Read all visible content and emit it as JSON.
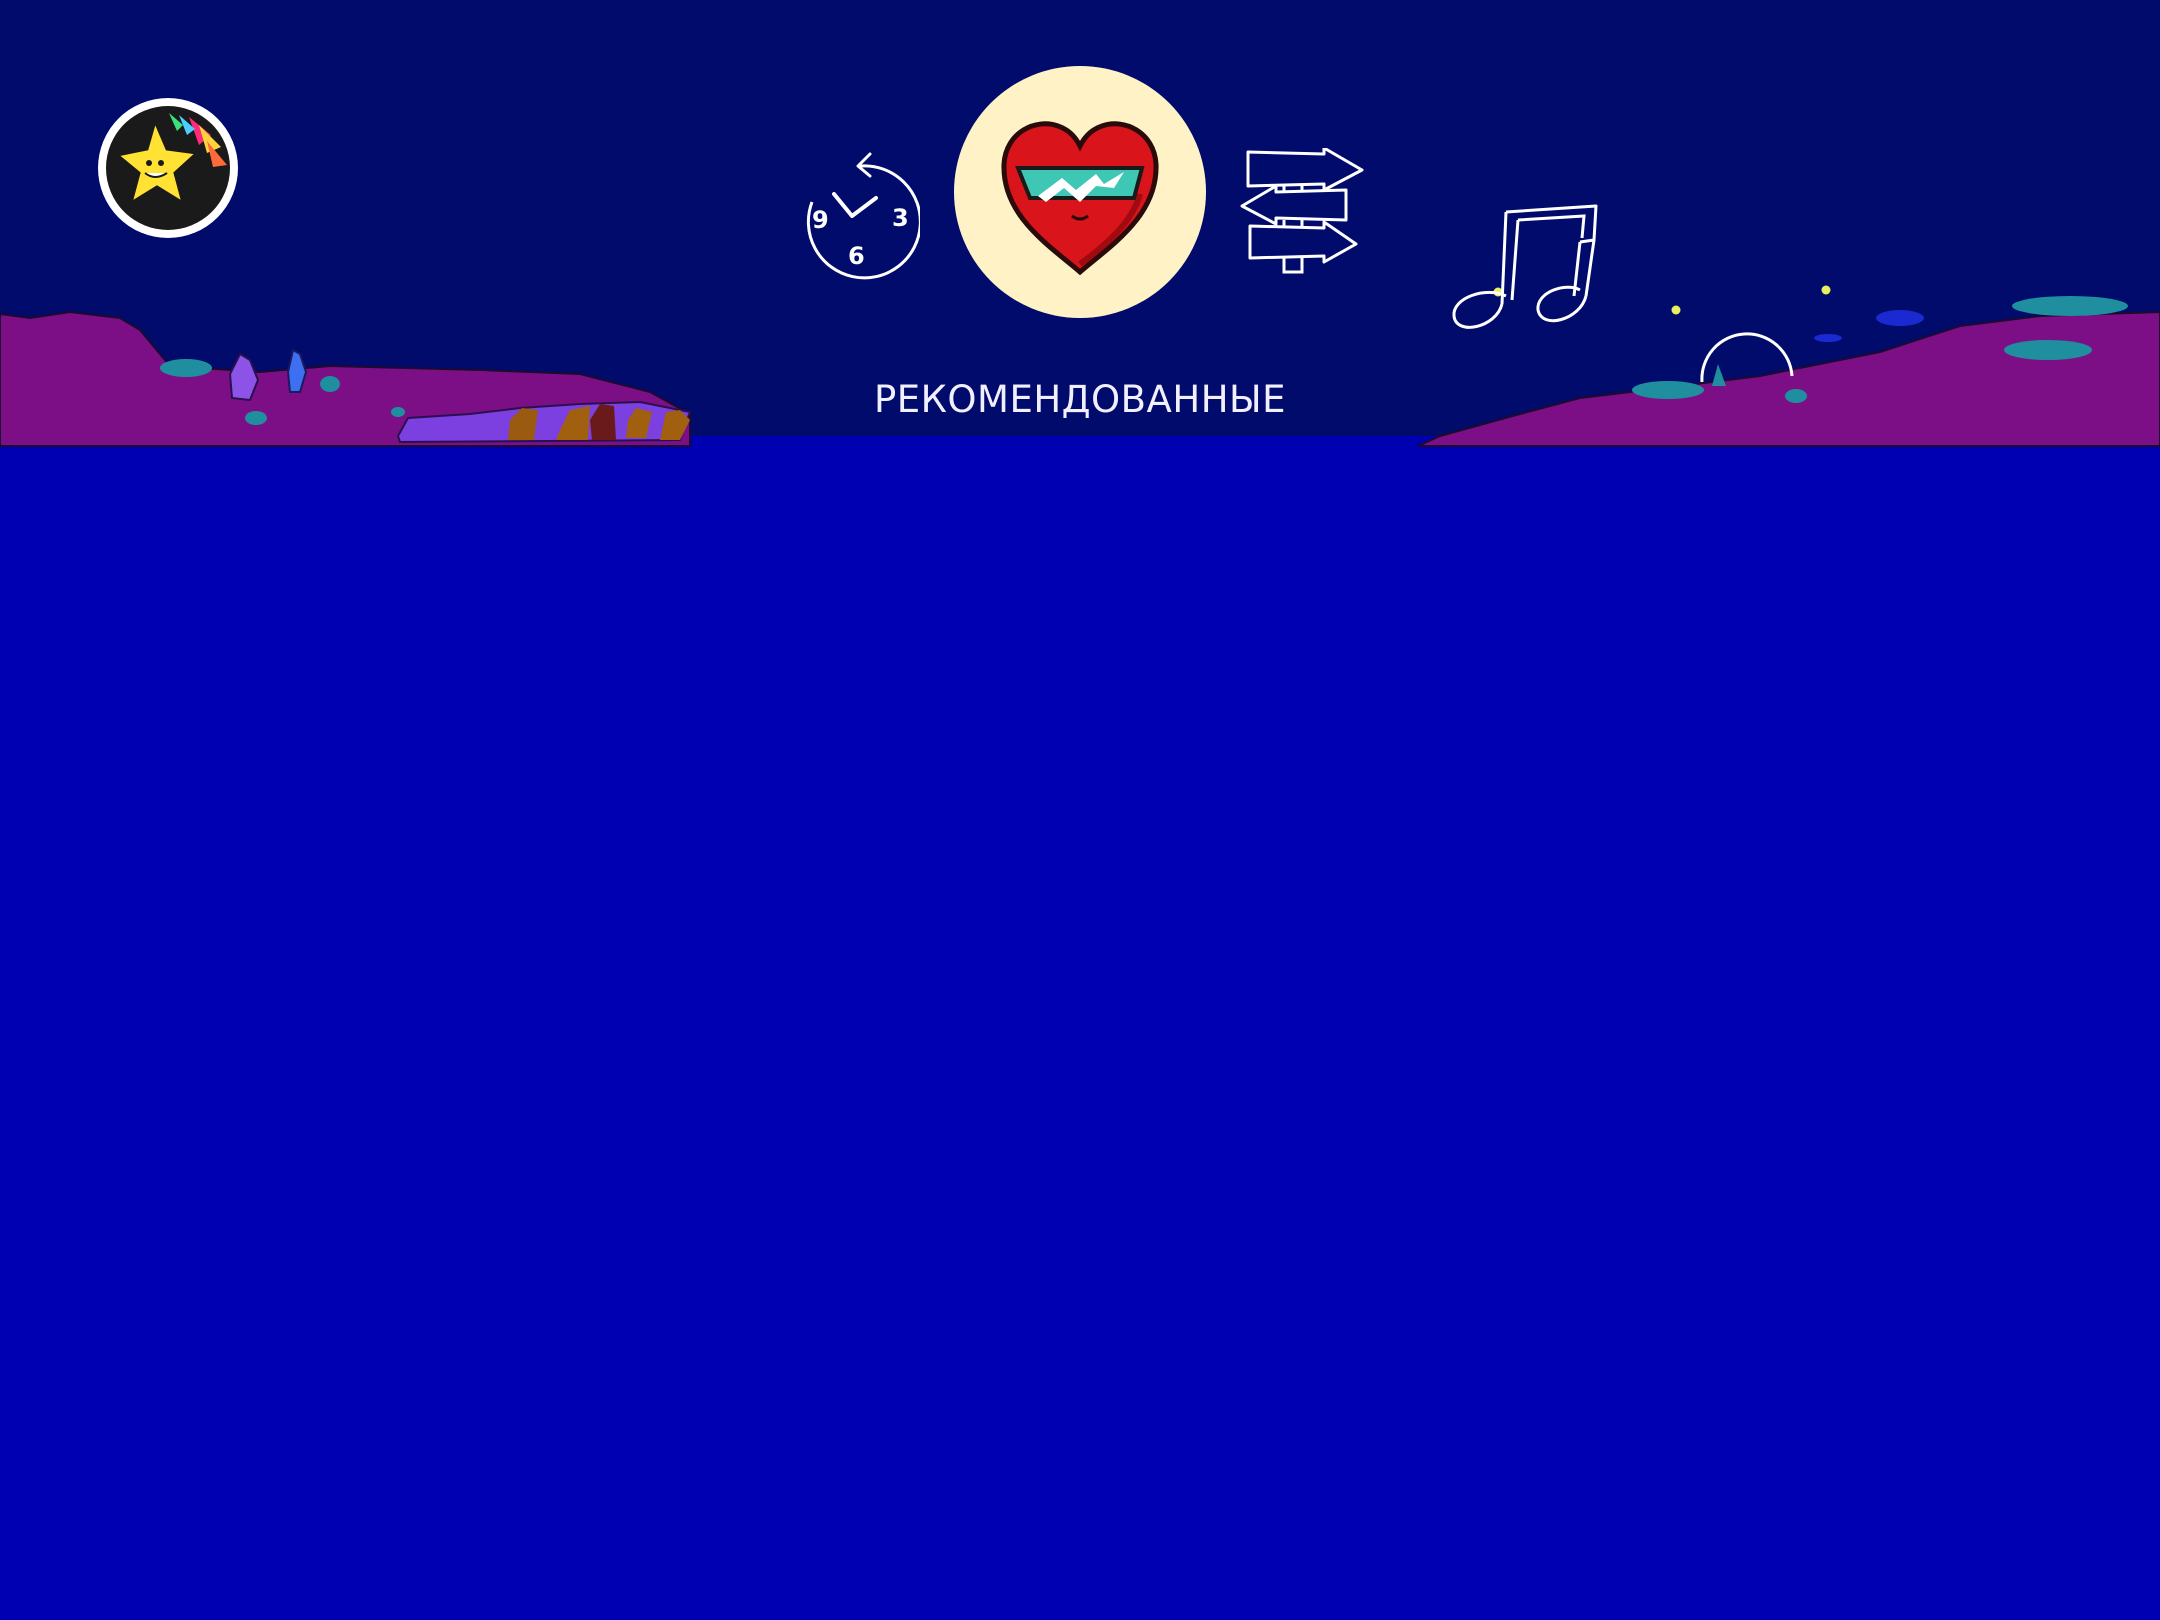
{
  "screen": {
    "section_title": "РЕКОМЕНДОВАННЫЕ",
    "active_tab": "favorites"
  },
  "header": {
    "avatar_icon": "star-avatar-icon",
    "nav_items": [
      {
        "id": "history",
        "icon": "clock-history-icon",
        "clock_numbers": [
          "9",
          "3",
          "6"
        ]
      },
      {
        "id": "favorites",
        "icon": "heart-sunglasses-icon",
        "selected": true
      },
      {
        "id": "directions",
        "icon": "signpost-arrows-icon"
      },
      {
        "id": "music",
        "icon": "music-notes-icon"
      }
    ]
  },
  "colors": {
    "sky": "#000b6b",
    "content_background": "#0000b3",
    "hills": "#7d0f86",
    "selected_circle": "#fff2c6",
    "heart": "#d9141a",
    "glasses": "#3fc7b5",
    "title_text": "#f2f0ff"
  }
}
